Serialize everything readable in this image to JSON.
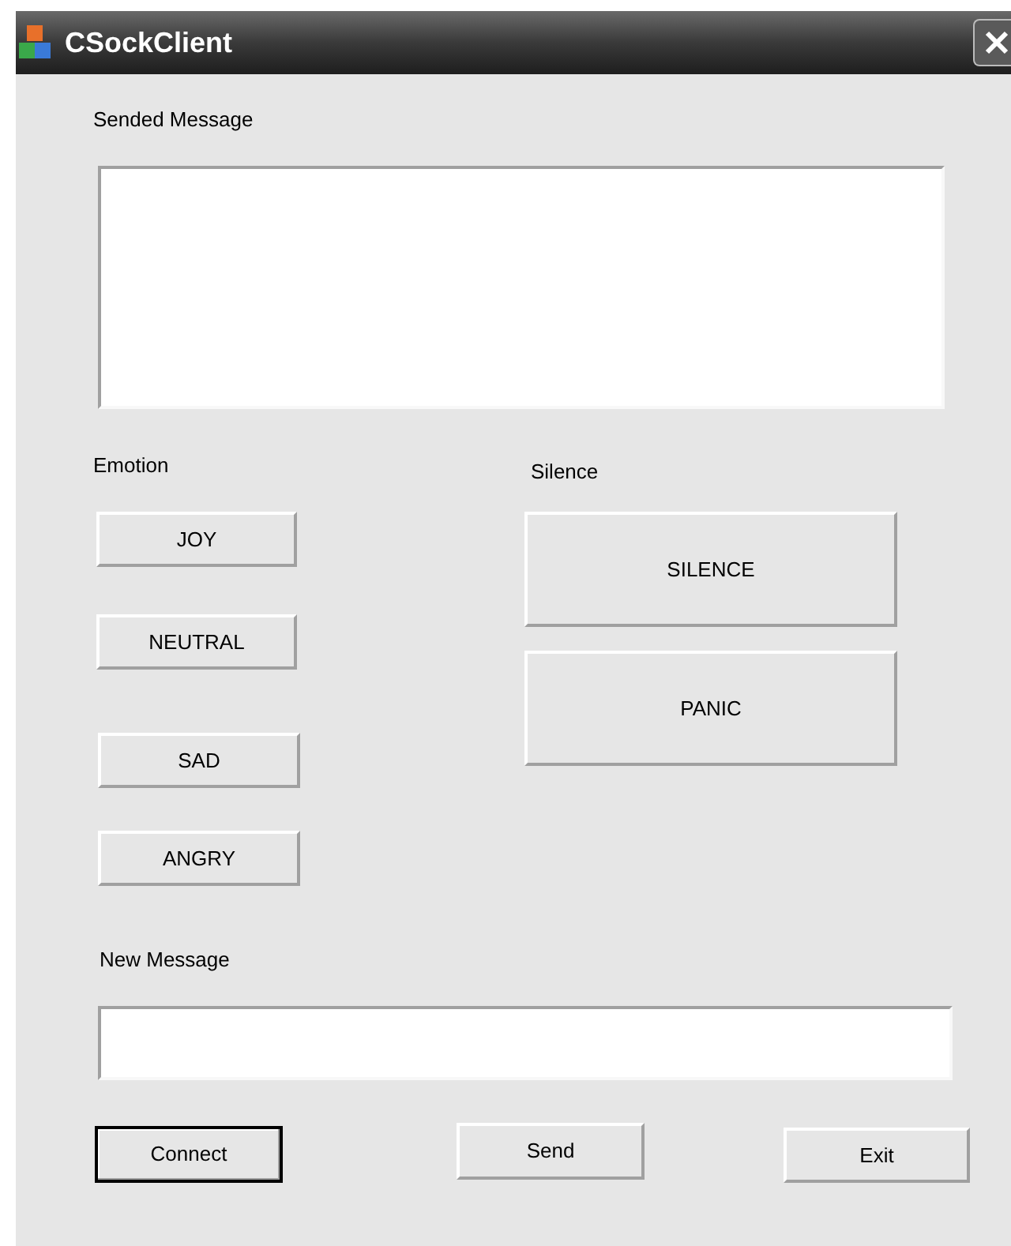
{
  "window": {
    "title": "CSockClient"
  },
  "sended_message": {
    "label": "Sended Message"
  },
  "emotion": {
    "label": "Emotion",
    "buttons": [
      "JOY",
      "NEUTRAL",
      "SAD",
      "ANGRY"
    ]
  },
  "silence": {
    "label": "Silence",
    "buttons": [
      "SILENCE",
      "PANIC"
    ]
  },
  "new_message": {
    "label": "New Message"
  },
  "buttons": [
    {
      "label": "Connect",
      "default": true
    },
    {
      "label": "Send",
      "default": false
    },
    {
      "label": "Exit",
      "default": false
    }
  ]
}
